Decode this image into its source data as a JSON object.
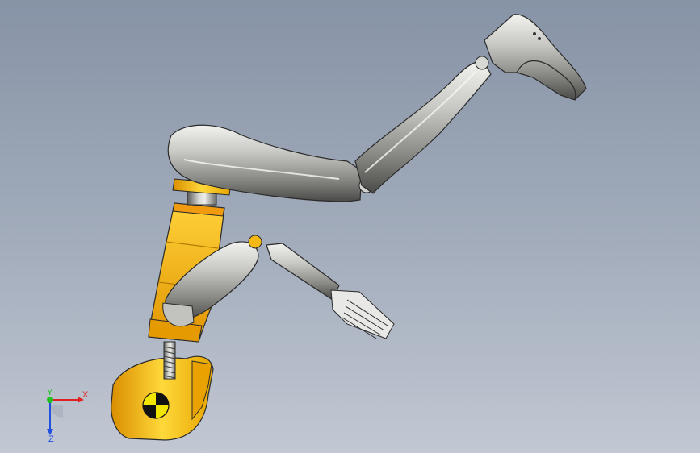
{
  "viewport": {
    "background_top": "#8793a6",
    "background_bottom": "#c2c8d3"
  },
  "model": {
    "parts": [
      "base-mount",
      "lead-screw",
      "linear-actuator-housing",
      "rotary-joint",
      "upper-arm-segment",
      "forearm-segment",
      "wrist-joint",
      "end-effector-pad",
      "secondary-arm-segment",
      "secondary-link",
      "gripper-hand"
    ],
    "colors": {
      "housing": "#f4b914",
      "housing_dark": "#d98e00",
      "metal_light": "#e6e6e2",
      "metal_mid": "#a6a6a2",
      "metal_dark": "#5a5a58",
      "outline": "#2a2a2a",
      "center_mark_yellow": "#f2e600",
      "center_mark_black": "#111111"
    }
  },
  "triad": {
    "x_label": "X",
    "y_label": "Y",
    "z_label": "Z",
    "x_color": "#e02020",
    "y_color": "#20c020",
    "z_color": "#2050e0"
  }
}
